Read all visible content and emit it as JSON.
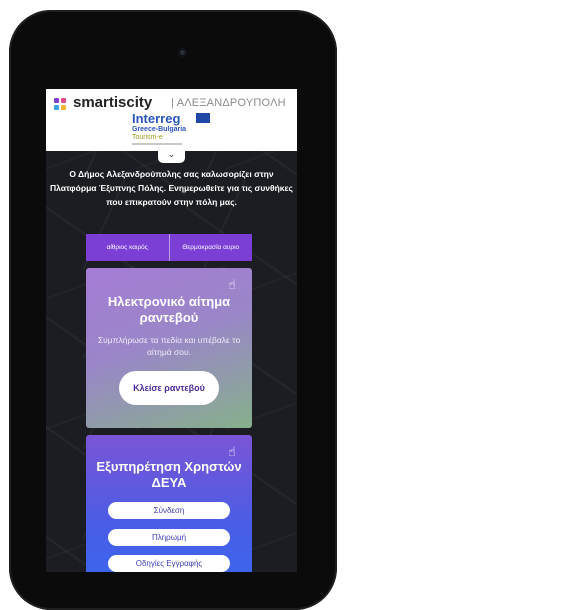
{
  "header": {
    "brand": "smartiscity",
    "city": "| ΑΛΕΞΑΝΔΡΟΥΠΟΛΗ",
    "program": "Interreg",
    "program_sub": "Greece-Bulgaria",
    "project": "Tourism-e",
    "logo_colors": [
      "#7b3fd6",
      "#e14b8a",
      "#3aa6e0",
      "#f2b632"
    ]
  },
  "welcome_text": "Ο Δήμος Αλεξανδρούπολης σας καλωσορίζει στην Πλατφόρμα Έξυπνης Πόλης. Ενημερωθείτε για τις συνθήκες που επικρατούν στην πόλη μας.",
  "weather_bar": {
    "items": [
      "αίθριος καιρός",
      "Θερμοκρασία αυριο"
    ]
  },
  "cards": {
    "appointment": {
      "title": "Ηλεκτρονικό αίτημα ραντεβού",
      "text": "Συμπλήρωσε τα πεδία και υπέβαλε το αίτημά σου.",
      "button": "Κλείσε ραντεβού"
    },
    "deya": {
      "title": "Εξυπηρέτηση Χρηστών ΔΕΥΑ",
      "buttons": [
        "Σύνδεση",
        "Πληρωμή",
        "Οδηγίες Εγγραφής"
      ]
    }
  },
  "icons": {
    "hand": "pointer-hand-icon",
    "chevron": "chevron-down-icon"
  }
}
